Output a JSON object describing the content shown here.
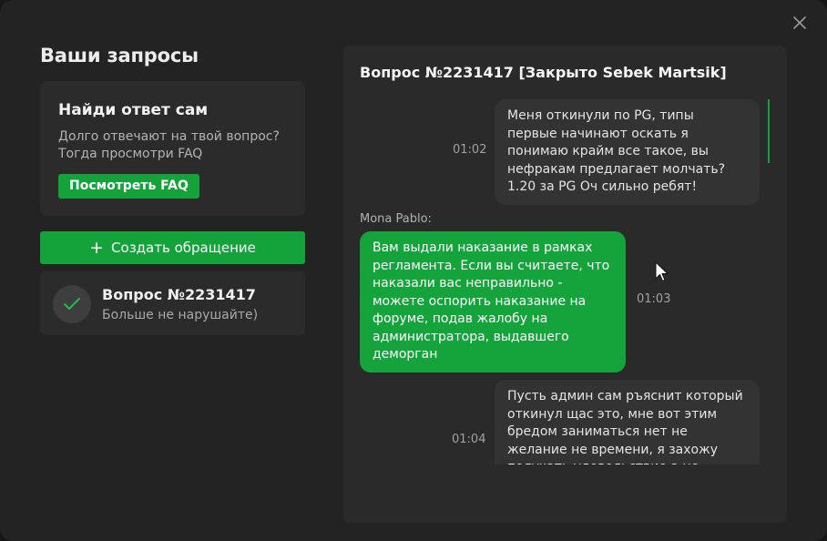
{
  "sidebar": {
    "title": "Ваши запросы",
    "faq_card": {
      "title": "Найди ответ сам",
      "text": "Долго отвечают на твой вопрос? Тогда просмотри FAQ",
      "button": "Посмотреть FAQ"
    },
    "create_button": "Создать обращение",
    "tickets": [
      {
        "title": "Вопрос №2231417",
        "subtitle": "Больше не нарушайте)"
      }
    ]
  },
  "chat": {
    "title": "Вопрос №2231417 [Закрыто Sebek Martsik]",
    "messages": [
      {
        "direction": "outgoing",
        "time": "01:02",
        "text": "Меня откинули по PG, типы первые начинают оскать я понимаю крайм все такое, вы нефракам предлагает молчать? 1.20 за PG Оч сильно ребят!"
      },
      {
        "direction": "incoming",
        "sender": "Mona Pablo:",
        "time": "01:03",
        "text": "Вам выдали наказание в рамках регламента. Если вы считаете, что наказали вас неправильно - можете оспорить наказание на форуме, подав жалобу на администратора, выдавшего деморган"
      },
      {
        "direction": "outgoing",
        "time": "01:04",
        "text": "Пусть админ сам ръяснит который откинул щас это, мне вот этим бредом заниматься нет не желание не времени, я захожу получать удовольствие а не"
      }
    ]
  },
  "colors": {
    "accent": "#14a33b",
    "background": "#232323",
    "panel": "#2a2a2a"
  },
  "icons": [
    "close-icon",
    "plus-icon",
    "check-icon",
    "mouse-cursor-icon"
  ]
}
